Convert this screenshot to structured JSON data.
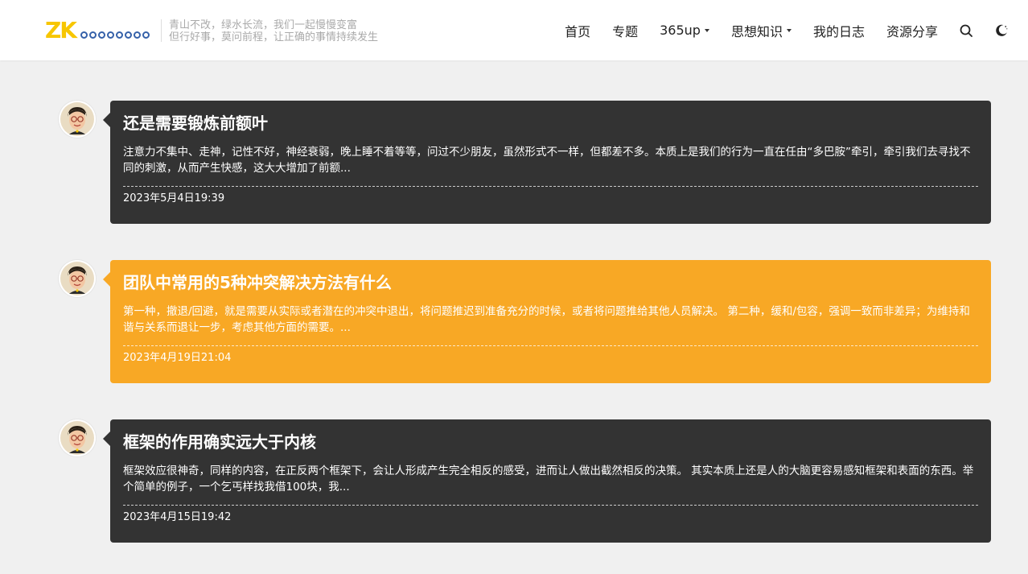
{
  "header": {
    "logo_text": "ZK",
    "slogan_line1": "青山不改，绿水长流，我们一起慢慢变富",
    "slogan_line2": "但行好事，莫问前程，让正确的事情持续发生",
    "nav": [
      {
        "label": "首页",
        "dropdown": false
      },
      {
        "label": "专题",
        "dropdown": false
      },
      {
        "label": "365up",
        "dropdown": true
      },
      {
        "label": "思想知识",
        "dropdown": true
      },
      {
        "label": "我的日志",
        "dropdown": false
      },
      {
        "label": "资源分享",
        "dropdown": false
      }
    ],
    "icons": [
      "search-icon",
      "dark-mode-icon"
    ]
  },
  "colors": {
    "background": "#f0f0f0",
    "card_dark": "#333333",
    "card_accent": "#f8a825",
    "logo_yellow": "#f7c600",
    "logo_blue": "#3561a9"
  },
  "posts": [
    {
      "title": "还是需要锻炼前额叶",
      "excerpt": "注意力不集中、走神，记性不好，神经衰弱，晚上睡不着等等，问过不少朋友，虽然形式不一样，但都差不多。本质上是我们的行为一直在任由“多巴胺”牵引，牵引我们去寻找不同的刺激，从而产生快感，这大大增加了前额...",
      "date": "2023年5月4日19:39",
      "color": "#333333"
    },
    {
      "title": "团队中常用的5种冲突解决方法有什么",
      "excerpt": "第一种，撤退/回避，就是需要从实际或者潜在的冲突中退出，将问题推迟到准备充分的时候，或者将问题推给其他人员解决。 第二种，缓和/包容，强调一致而非差异；为维持和谐与关系而退让一步，考虑其他方面的需要。...",
      "date": "2023年4月19日21:04",
      "color": "#f8a825"
    },
    {
      "title": "框架的作用确实远大于内核",
      "excerpt": "框架效应很神奇，同样的内容，在正反两个框架下，会让人形成产生完全相反的感受，进而让人做出截然相反的决策。 其实本质上还是人的大脑更容易感知框架和表面的东西。举个简单的例子，一个乞丐样找我借100块，我...",
      "date": "2023年4月15日19:42",
      "color": "#333333"
    }
  ]
}
